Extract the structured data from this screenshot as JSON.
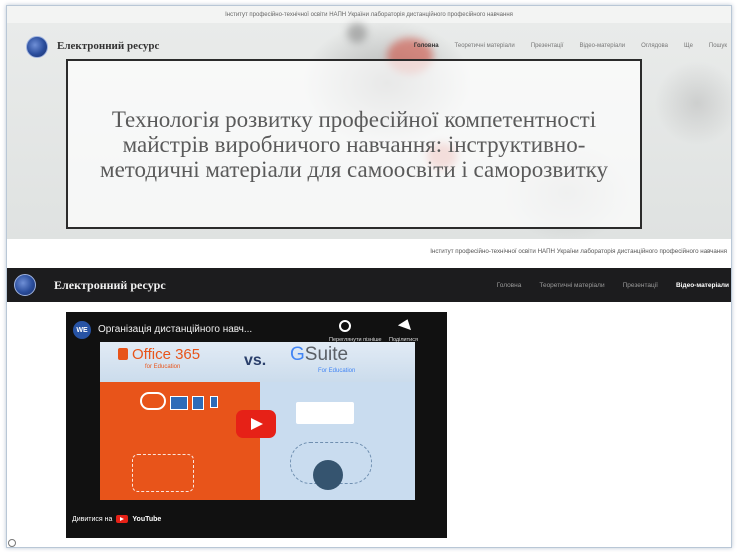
{
  "top": {
    "banner": "Інститут професійно-технічної освіти НАПН України лабораторія дистанційного професійного навчання",
    "site_title": "Електронний ресурс",
    "menu": [
      "Головна",
      "Теоретичні матеріали",
      "Презентації",
      "Відео-матеріали",
      "Оглядова",
      "Ще",
      "Пошук"
    ],
    "hero_title": "Технологія розвитку професійної компетентності майстрів виробничого навчання: інструктивно-методичні матеріали для самоосвіти і саморозвитку"
  },
  "bottom": {
    "banner": "Інститут професійно-технічної освіти НАПН України лабораторія дистанційного професійного навчання",
    "site_title": "Електронний ресурс",
    "menu": [
      "Головна",
      "Теоретичні матеріали",
      "Презентації",
      "Відео-матеріали"
    ],
    "video": {
      "channel_badge": "WE",
      "title": "Організація дистанційного навч...",
      "watch_later": "Переглянути пізніше",
      "share": "Поділитися",
      "watch_on": "Дивитися на",
      "youtube": "YouTube",
      "thumb_office": "Office 365",
      "thumb_office_sub": "for Education",
      "thumb_vs": "vs.",
      "thumb_gsuite_g": "G",
      "thumb_gsuite_rest": "Suite",
      "thumb_gsuite_sub": "For Education"
    }
  },
  "colors": {
    "office_orange": "#e8541a",
    "gsuite_blue": "#4285f4",
    "youtube_red": "#e62117",
    "dark_nav": "#1c1c1e"
  }
}
